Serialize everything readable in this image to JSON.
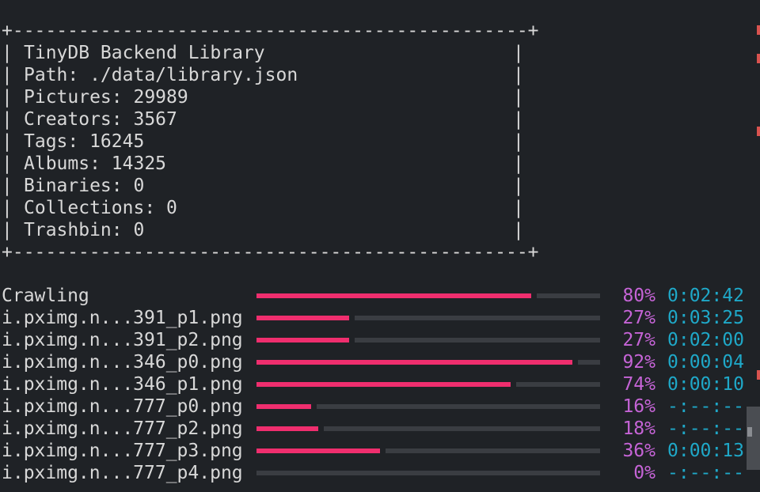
{
  "library_box": {
    "border_top": "+-----------------------------------------------+",
    "border_bottom": "+-----------------------------------------------+",
    "side_left": "|",
    "side_right": "|",
    "lines": [
      "TinyDB Backend Library",
      "Path: ./data/library.json",
      "Pictures: 29989",
      "Creators: 3567",
      "Tags: 16245",
      "Albums: 14325",
      "Binaries: 0",
      "Collections: 0",
      "Trashbin: 0"
    ]
  },
  "progress": {
    "colors": {
      "bar_fill": "#ef2e6e",
      "bar_track": "#3a3d42",
      "percent": "#c564d6",
      "eta": "#1fa8c8"
    },
    "rows": [
      {
        "name": "Crawling",
        "fraction": 0.8,
        "percent": "80%",
        "eta": "0:02:42"
      },
      {
        "name": "i.pximg.n...391_p1.png",
        "fraction": 0.27,
        "percent": "27%",
        "eta": "0:03:25"
      },
      {
        "name": "i.pximg.n...391_p2.png",
        "fraction": 0.27,
        "percent": "27%",
        "eta": "0:02:00"
      },
      {
        "name": "i.pximg.n...346_p0.png",
        "fraction": 0.92,
        "percent": "92%",
        "eta": "0:00:04"
      },
      {
        "name": "i.pximg.n...346_p1.png",
        "fraction": 0.74,
        "percent": "74%",
        "eta": "0:00:10"
      },
      {
        "name": "i.pximg.n...777_p0.png",
        "fraction": 0.16,
        "percent": "16%",
        "eta": "-:--:--"
      },
      {
        "name": "i.pximg.n...777_p2.png",
        "fraction": 0.18,
        "percent": "18%",
        "eta": "-:--:--"
      },
      {
        "name": "i.pximg.n...777_p3.png",
        "fraction": 0.36,
        "percent": "36%",
        "eta": "0:00:13"
      },
      {
        "name": "i.pximg.n...777_p4.png",
        "fraction": 0.0,
        "percent": "0%",
        "eta": "-:--:--"
      }
    ]
  }
}
